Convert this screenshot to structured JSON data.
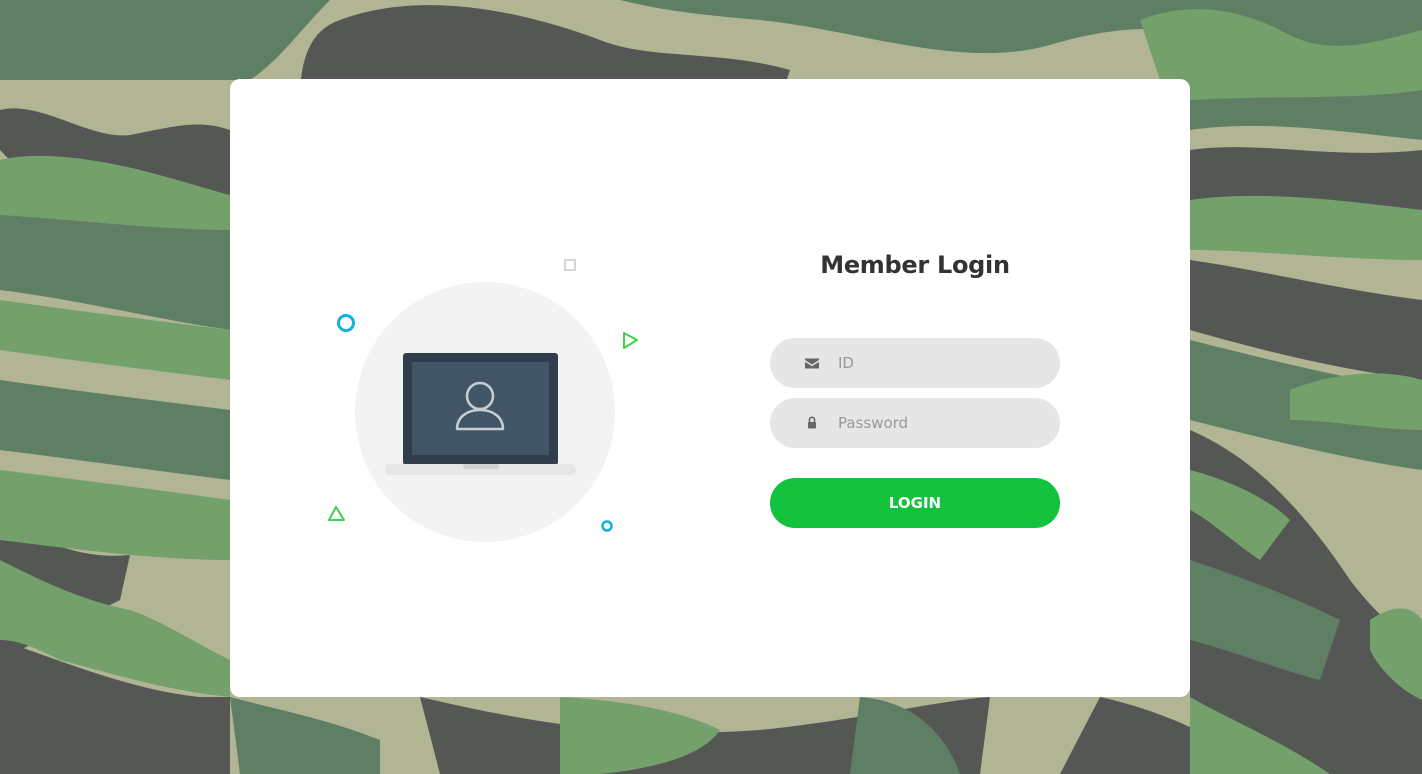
{
  "page": {
    "background_pattern": "camouflage",
    "camo_colors": [
      "#b1b593",
      "#5e7f63",
      "#73a06b",
      "#545754"
    ]
  },
  "illustration": {
    "icon": "laptop-user-icon",
    "circle_color": "#f3f3f3",
    "laptop_frame_color": "#2f3d4c",
    "laptop_screen_color": "#425566"
  },
  "form": {
    "title": "Member Login",
    "id_field": {
      "icon": "envelope-icon",
      "placeholder": "ID",
      "value": ""
    },
    "password_field": {
      "icon": "lock-icon",
      "placeholder": "Password",
      "value": ""
    },
    "login_button": {
      "label": "LOGIN",
      "color": "#14c13c"
    }
  }
}
